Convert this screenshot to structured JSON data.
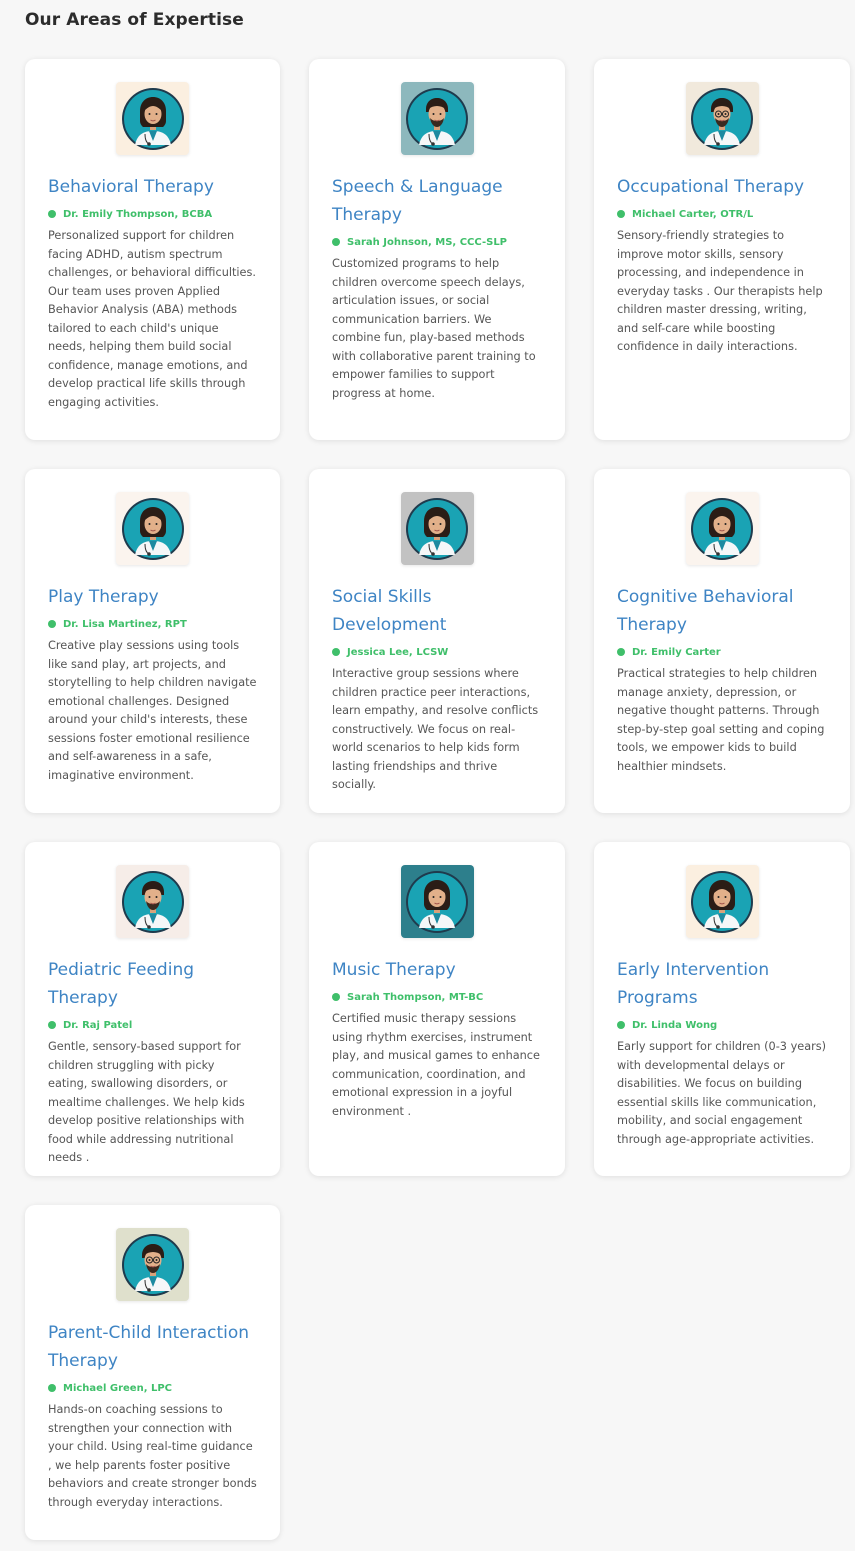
{
  "section": {
    "title": "Our Areas of Expertise"
  },
  "colors": {
    "title_blue": "#3e84c4",
    "therapist_green": "#3fbf6a",
    "card_bg": "#ffffff",
    "page_bg": "#f7f7f7"
  },
  "cards": [
    {
      "title": "Behavioral Therapy",
      "therapist": "Dr. Emily Thompson, BCBA",
      "description": "Personalized support for children facing ADHD, autism spectrum challenges, or behavioral difficulties. Our team uses proven Applied Behavior Analysis (ABA) methods tailored to each child's unique needs, helping them build social confidence, manage emotions, and develop practical life skills through engaging activities.",
      "avatar": {
        "icon": "female-doctor-icon",
        "bg": "#fbefe0"
      }
    },
    {
      "title": "Speech & Language Therapy",
      "therapist": "Sarah Johnson, MS, CCC-SLP",
      "description": "Customized programs to help children overcome speech delays, articulation issues, or social communication barriers. We combine fun, play-based methods with collaborative parent training to empower families to support progress at home.",
      "avatar": {
        "icon": "male-doctor-icon",
        "bg": "#8db8bd"
      }
    },
    {
      "title": "Occupational Therapy",
      "therapist": "Michael Carter, OTR/L",
      "description": "Sensory-friendly strategies to improve motor skills, sensory processing, and independence in everyday tasks . Our therapists help children master dressing, writing, and self-care while boosting confidence in daily interactions.",
      "avatar": {
        "icon": "male-doctor-glasses-icon",
        "bg": "#f1e9dc"
      }
    },
    {
      "title": "Play Therapy",
      "therapist": "Dr. Lisa Martinez, RPT",
      "description": "Creative play sessions using tools like sand play, art projects, and storytelling to help children navigate emotional challenges. Designed around your child's interests, these sessions foster emotional resilience and self-awareness in a safe, imaginative environment.",
      "avatar": {
        "icon": "female-doctor-icon",
        "bg": "#fbf4ee"
      }
    },
    {
      "title": "Social Skills Development",
      "therapist": "Jessica Lee, LCSW",
      "description": "Interactive group sessions where children practice peer interactions, learn empathy, and resolve conflicts constructively. We focus on real-world scenarios to help kids form lasting friendships and thrive socially.",
      "avatar": {
        "icon": "female-doctor-icon",
        "bg": "#c2c2c2"
      }
    },
    {
      "title": "Cognitive Behavioral Therapy",
      "therapist": "Dr. Emily Carter",
      "description": "Practical strategies to help children manage anxiety, depression, or negative thought patterns. Through step-by-step goal setting and coping tools, we empower kids to build healthier mindsets.",
      "avatar": {
        "icon": "female-doctor-icon",
        "bg": "#fbf4ee"
      }
    },
    {
      "title": "Pediatric Feeding Therapy",
      "therapist": "Dr. Raj Patel",
      "description": "Gentle, sensory-based support for children struggling with picky eating, swallowing disorders, or mealtime challenges. We help kids develop positive relationships with food while addressing nutritional needs .",
      "avatar": {
        "icon": "male-doctor-icon",
        "bg": "#f6ede8"
      }
    },
    {
      "title": "Music Therapy",
      "therapist": "Sarah Thompson, MT-BC",
      "description": "Certified music therapy sessions using rhythm exercises, instrument play, and musical games to enhance communication, coordination, and emotional expression in a joyful environment .",
      "avatar": {
        "icon": "female-doctor-icon",
        "bg": "#2d7f8c"
      }
    },
    {
      "title": "Early Intervention Programs",
      "therapist": "Dr. Linda Wong",
      "description": "Early support for children (0-3 years) with developmental delays or disabilities. We focus on building essential skills like communication, mobility, and social engagement through age-appropriate activities.",
      "avatar": {
        "icon": "female-doctor-icon",
        "bg": "#fbefe0"
      }
    },
    {
      "title": "Parent-Child Interaction Therapy",
      "therapist": "Michael Green, LPC",
      "description": "Hands-on coaching sessions to strengthen your connection with your child. Using real-time guidance , we help parents foster positive behaviors and create stronger bonds through everyday interactions.",
      "avatar": {
        "icon": "male-doctor-glasses-icon",
        "bg": "#dfe0cc"
      }
    }
  ]
}
